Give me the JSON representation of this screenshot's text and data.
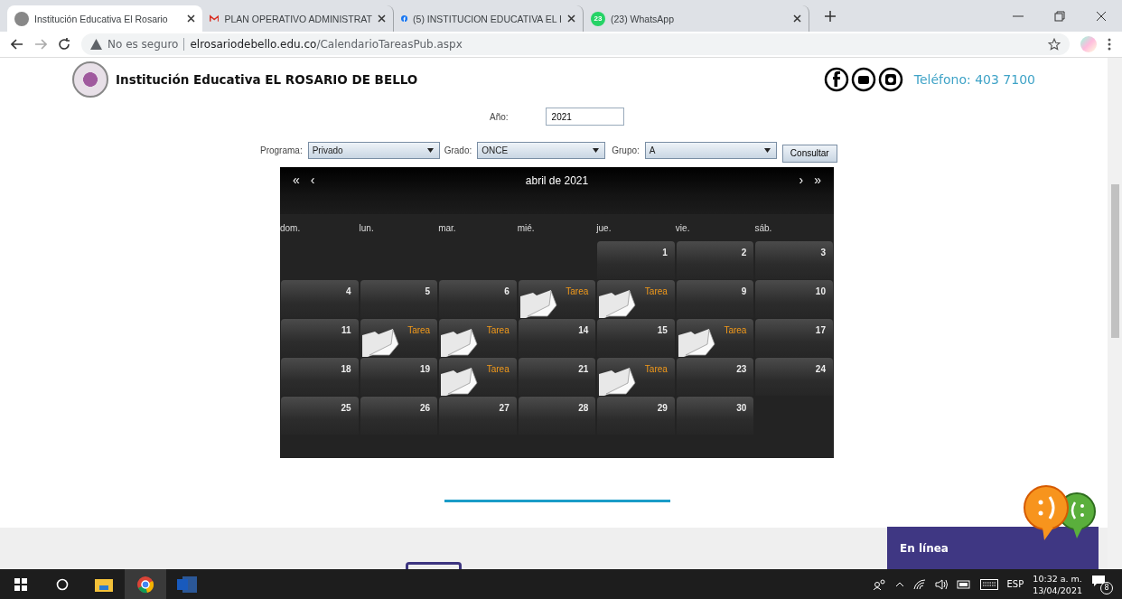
{
  "browser": {
    "tabs": [
      {
        "title": "Institución Educativa El Rosario",
        "selected": true,
        "kind": "school"
      },
      {
        "title": "PLAN OPERATIVO ADMINISTRAT",
        "selected": false,
        "kind": "mail"
      },
      {
        "title": "(5) INSTITUCION EDUCATIVA EL I",
        "selected": false,
        "kind": "social"
      },
      {
        "title": "(23) WhatsApp",
        "selected": false,
        "kind": "chat",
        "badge": "23"
      }
    ],
    "security": "No es seguro",
    "url_domain": "elrosariodebello.edu.co",
    "url_path": "/CalendarioTareasPub.aspx"
  },
  "header": {
    "title": "Institución Educativa EL ROSARIO DE BELLO",
    "phone": "Teléfono: 403 7100"
  },
  "form": {
    "year_label": "Año:",
    "year": "2021",
    "program_label": "Programa:",
    "program": "Privado",
    "grade_label": "Grado:",
    "grade": "ONCE",
    "group_label": "Grupo:",
    "group": "A",
    "submit": "Consultar"
  },
  "calendar": {
    "prev_year": "«",
    "prev_month": "‹",
    "title": "abril de 2021",
    "next_month": "›",
    "next_year": "»",
    "weekdays": [
      "dom.",
      "lun.",
      "mar.",
      "mié.",
      "jue.",
      "vie.",
      "sáb."
    ],
    "weeks": [
      [
        {
          "kind": "empty"
        },
        {
          "kind": "empty"
        },
        {
          "kind": "empty"
        },
        {
          "kind": "empty"
        },
        {
          "kind": "day",
          "text": "1"
        },
        {
          "kind": "day",
          "text": "2"
        },
        {
          "kind": "day",
          "text": "3"
        }
      ],
      [
        {
          "kind": "day",
          "text": "4"
        },
        {
          "kind": "day",
          "text": "5"
        },
        {
          "kind": "day",
          "text": "6"
        },
        {
          "kind": "task",
          "text": "Tarea"
        },
        {
          "kind": "task",
          "text": "Tarea"
        },
        {
          "kind": "day",
          "text": "9"
        },
        {
          "kind": "day",
          "text": "10"
        }
      ],
      [
        {
          "kind": "day",
          "text": "11"
        },
        {
          "kind": "task",
          "text": "Tarea"
        },
        {
          "kind": "task",
          "text": "Tarea"
        },
        {
          "kind": "day",
          "text": "14"
        },
        {
          "kind": "day",
          "text": "15"
        },
        {
          "kind": "task",
          "text": "Tarea"
        },
        {
          "kind": "day",
          "text": "17"
        }
      ],
      [
        {
          "kind": "day",
          "text": "18"
        },
        {
          "kind": "day",
          "text": "19"
        },
        {
          "kind": "task",
          "text": "Tarea"
        },
        {
          "kind": "day",
          "text": "21"
        },
        {
          "kind": "task",
          "text": "Tarea"
        },
        {
          "kind": "day",
          "text": "23"
        },
        {
          "kind": "day",
          "text": "24"
        }
      ],
      [
        {
          "kind": "day",
          "text": "25"
        },
        {
          "kind": "day",
          "text": "26"
        },
        {
          "kind": "day",
          "text": "27"
        },
        {
          "kind": "day",
          "text": "28"
        },
        {
          "kind": "day",
          "text": "29"
        },
        {
          "kind": "day",
          "text": "30"
        },
        {
          "kind": "empty"
        }
      ]
    ]
  },
  "chat_widget": {
    "status": "En línea"
  },
  "taskbar": {
    "language": "ESP",
    "time": "10:32 a. m.",
    "date": "13/04/2021",
    "notifications": "8"
  }
}
